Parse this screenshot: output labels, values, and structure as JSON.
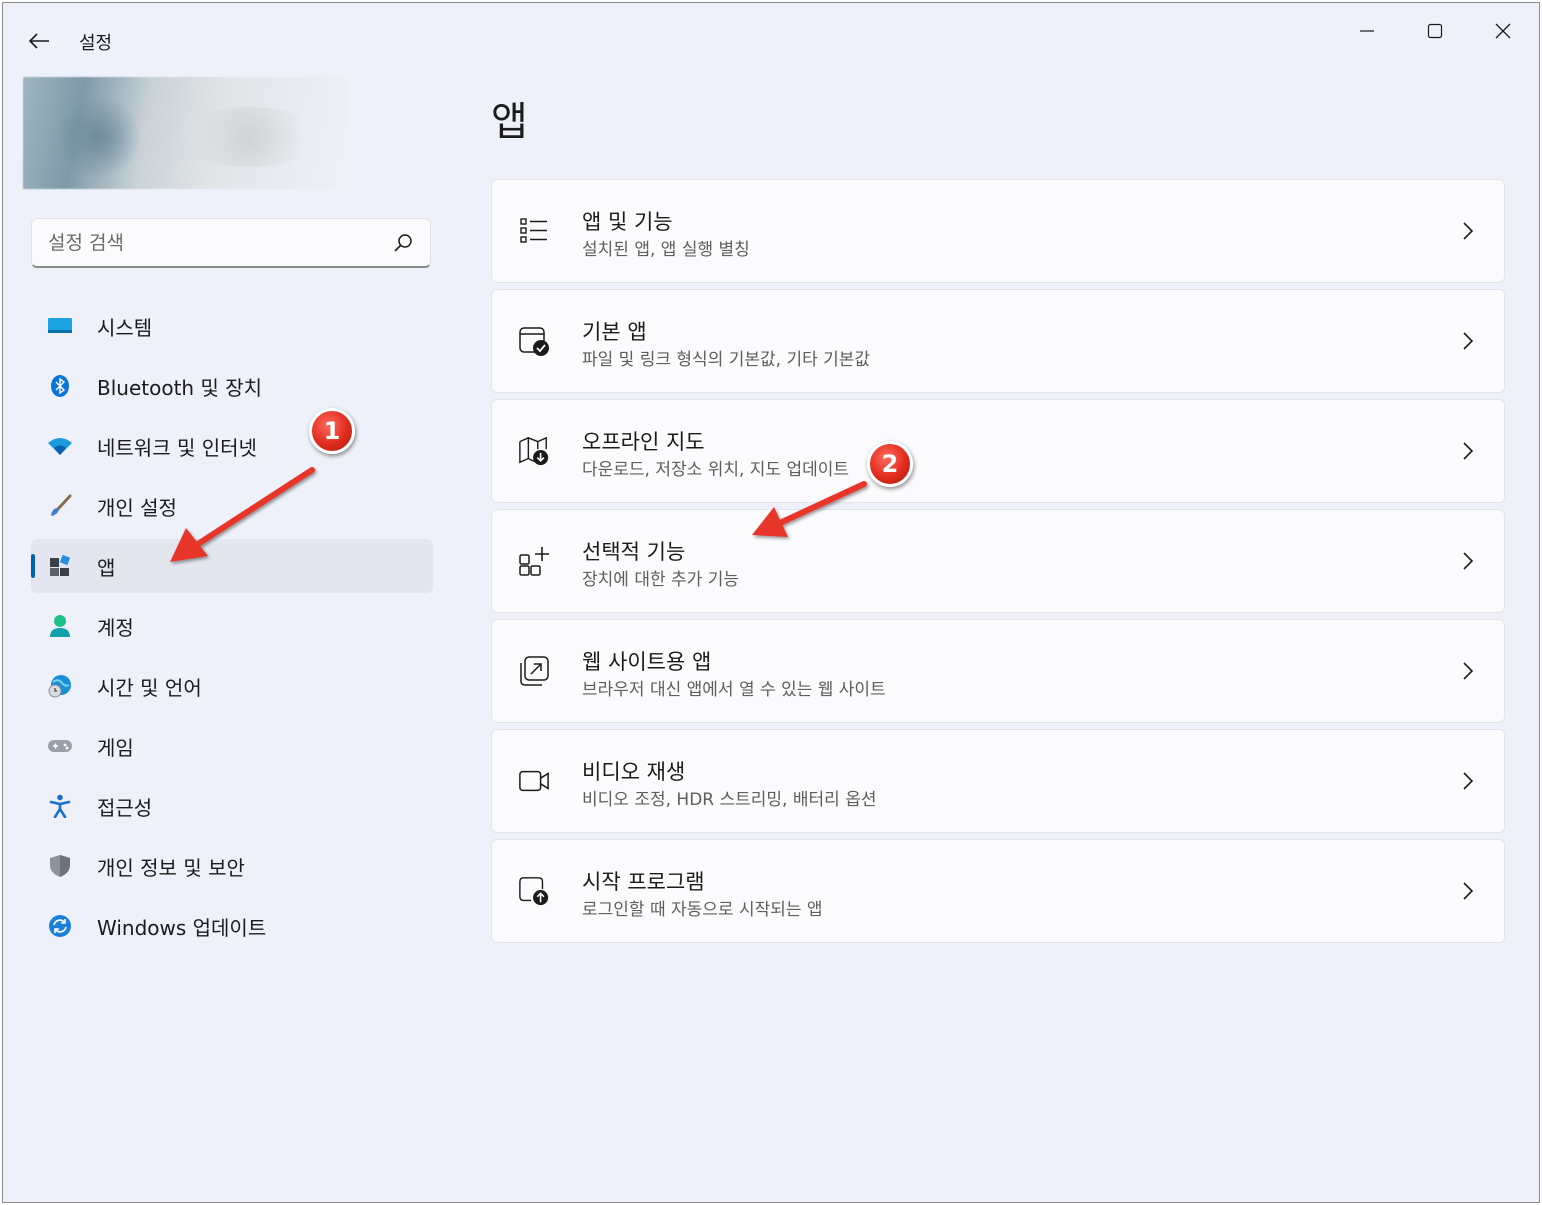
{
  "window": {
    "title": "설정",
    "controls": {
      "minimize": "minimize",
      "maximize": "maximize",
      "close": "close"
    }
  },
  "search": {
    "placeholder": "설정 검색"
  },
  "sidebar": {
    "items": [
      {
        "label": "시스템",
        "icon": "system-icon",
        "selected": false
      },
      {
        "label": "Bluetooth 및 장치",
        "icon": "bluetooth-icon",
        "selected": false
      },
      {
        "label": "네트워크 및 인터넷",
        "icon": "wifi-icon",
        "selected": false
      },
      {
        "label": "개인 설정",
        "icon": "brush-icon",
        "selected": false
      },
      {
        "label": "앱",
        "icon": "apps-icon",
        "selected": true
      },
      {
        "label": "계정",
        "icon": "account-icon",
        "selected": false
      },
      {
        "label": "시간 및 언어",
        "icon": "globe-clock-icon",
        "selected": false
      },
      {
        "label": "게임",
        "icon": "gamepad-icon",
        "selected": false
      },
      {
        "label": "접근성",
        "icon": "accessibility-icon",
        "selected": false
      },
      {
        "label": "개인 정보 및 보안",
        "icon": "shield-icon",
        "selected": false
      },
      {
        "label": "Windows 업데이트",
        "icon": "update-icon",
        "selected": false
      }
    ]
  },
  "main": {
    "title": "앱",
    "cards": [
      {
        "title": "앱 및 기능",
        "subtitle": "설치된 앱, 앱 실행 별칭",
        "icon": "list-icon"
      },
      {
        "title": "기본 앱",
        "subtitle": "파일 및 링크 형식의 기본값, 기타 기본값",
        "icon": "default-apps-icon"
      },
      {
        "title": "오프라인 지도",
        "subtitle": "다운로드, 저장소 위치, 지도 업데이트",
        "icon": "map-download-icon"
      },
      {
        "title": "선택적 기능",
        "subtitle": "장치에 대한 추가 기능",
        "icon": "add-feature-icon"
      },
      {
        "title": "웹 사이트용 앱",
        "subtitle": "브라우저 대신 앱에서 열 수 있는 웹 사이트",
        "icon": "open-external-icon"
      },
      {
        "title": "비디오 재생",
        "subtitle": "비디오 조정, HDR 스트리밍, 배터리 옵션",
        "icon": "video-icon"
      },
      {
        "title": "시작 프로그램",
        "subtitle": "로그인할 때 자동으로 시작되는 앱",
        "icon": "startup-icon"
      }
    ]
  },
  "annotations": {
    "marker1": "1",
    "marker2": "2"
  },
  "colors": {
    "accent": "#0063b1",
    "background": "#eef1f9",
    "card": "#fbfbfd",
    "annotation": "#e02b1e"
  }
}
